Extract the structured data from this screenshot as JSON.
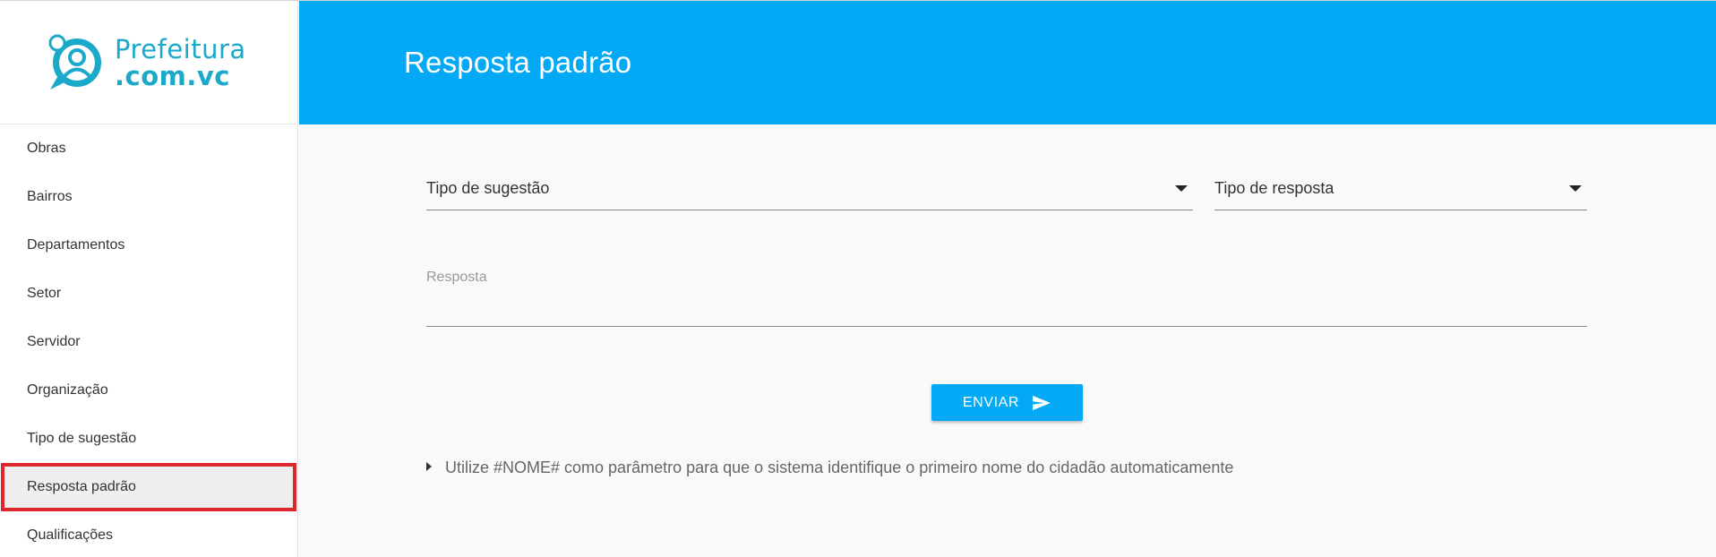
{
  "brand": {
    "line1": "Prefeitura",
    "line2": ".com.vc",
    "color": "#1aa9c9"
  },
  "sidebar": {
    "items": [
      {
        "label": "Obras",
        "active": false
      },
      {
        "label": "Bairros",
        "active": false
      },
      {
        "label": "Departamentos",
        "active": false
      },
      {
        "label": "Setor",
        "active": false
      },
      {
        "label": "Servidor",
        "active": false
      },
      {
        "label": "Organização",
        "active": false
      },
      {
        "label": "Tipo de sugestão",
        "active": false
      },
      {
        "label": "Resposta padrão",
        "active": true
      },
      {
        "label": "Qualificações",
        "active": false
      }
    ]
  },
  "header": {
    "title": "Resposta padrão",
    "background": "#03a9f4"
  },
  "form": {
    "tipo_sugestao_label": "Tipo de sugestão",
    "tipo_resposta_label": "Tipo de resposta",
    "resposta_placeholder": "Resposta",
    "send_label": "ENVIAR"
  },
  "hint": {
    "text": "Utilize #NOME# como parâmetro para que o sistema identifique o primeiro nome do cidadão automaticamente"
  },
  "icons": {
    "logo": "user-chat-icon",
    "dropdown": "caret-down-icon",
    "send": "send-icon",
    "hint": "triangle-right-icon"
  },
  "colors": {
    "accent": "#03a9f4",
    "highlight_border": "#e0262d"
  }
}
